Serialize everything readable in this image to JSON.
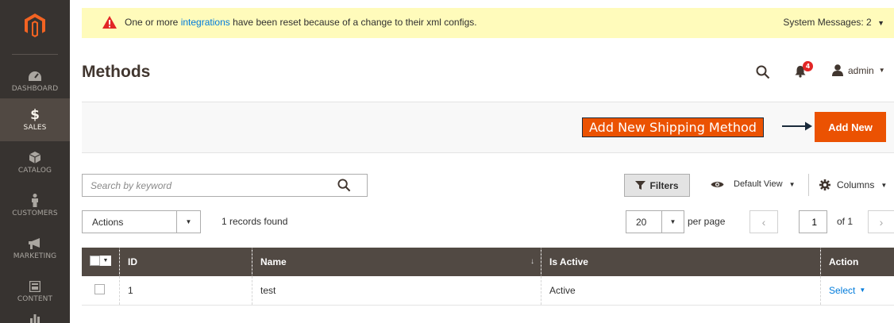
{
  "sidebar": {
    "items": [
      {
        "label": "DASHBOARD",
        "icon": "dashboard-icon"
      },
      {
        "label": "SALES",
        "icon": "dollar-icon",
        "active": true
      },
      {
        "label": "CATALOG",
        "icon": "box-icon"
      },
      {
        "label": "CUSTOMERS",
        "icon": "person-icon"
      },
      {
        "label": "MARKETING",
        "icon": "megaphone-icon"
      },
      {
        "label": "CONTENT",
        "icon": "layout-icon"
      }
    ]
  },
  "system_message": {
    "text_before": "One or more ",
    "link": "integrations",
    "text_after": " have been reset because of a change to their xml configs.",
    "right_label": "System Messages: 2"
  },
  "header": {
    "title": "Methods",
    "notification_count": "4",
    "user": "admin"
  },
  "actionbar": {
    "callout": "Add New Shipping Method",
    "add_new_label": "Add New"
  },
  "search": {
    "placeholder": "Search by keyword"
  },
  "toolbar": {
    "filters_label": "Filters",
    "view_label": "Default View",
    "columns_label": "Columns",
    "actions_label": "Actions",
    "records_found": "1 records found",
    "per_page_value": "20",
    "per_page_label": "per page",
    "page_value": "1",
    "page_of": "of 1"
  },
  "table": {
    "columns": [
      "ID",
      "Name",
      "Is Active",
      "Action"
    ],
    "rows": [
      {
        "id": "1",
        "name": "test",
        "is_active": "Active",
        "action": "Select"
      }
    ]
  },
  "colors": {
    "sidebar_bg": "#373330",
    "accent": "#eb5202",
    "header_bg": "#514943",
    "link": "#007bdb",
    "message_bg": "#fffbbb"
  }
}
